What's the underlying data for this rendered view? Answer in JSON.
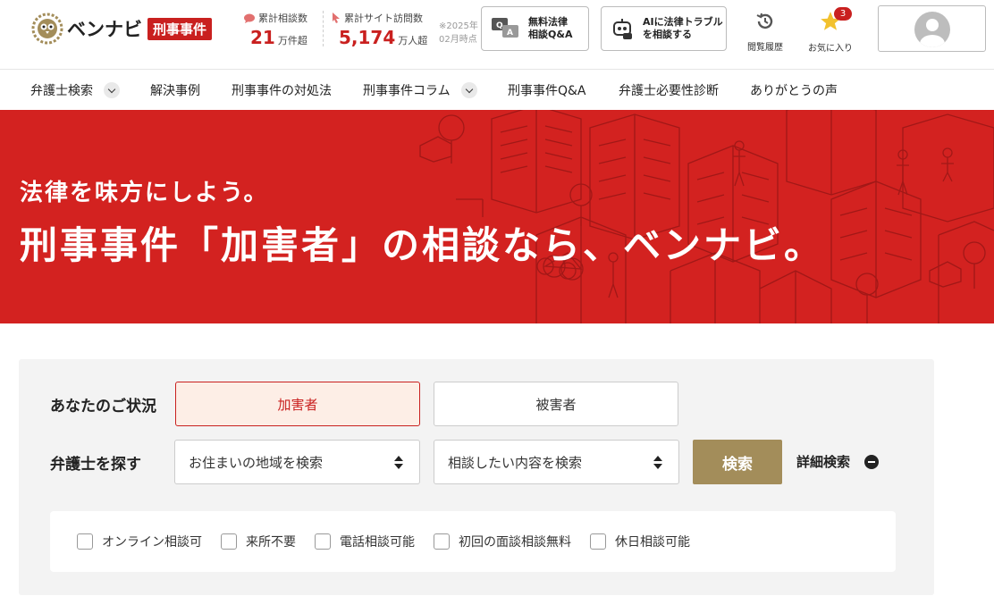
{
  "header": {
    "logo_text": "ベンナビ",
    "logo_badge": "刑事事件",
    "stats": [
      {
        "label": "累計相談数",
        "value": "21",
        "unit": "万件超"
      },
      {
        "label": "累計サイト訪問数",
        "value": "5,174",
        "unit": "万人超"
      }
    ],
    "stat_note_line1": "※2025年",
    "stat_note_line2": "02月時点",
    "qa_button": {
      "line1": "無料法律",
      "line2": "相談Q&A"
    },
    "ai_button": {
      "line1": "AIに法律トラブル",
      "line2": "を相談する"
    },
    "history_label": "閲覧履歴",
    "favorites_label": "お気に入り",
    "favorites_count": "3"
  },
  "nav": {
    "items": [
      {
        "label": "弁護士検索",
        "dropdown": true
      },
      {
        "label": "解決事例",
        "dropdown": false
      },
      {
        "label": "刑事事件の対処法",
        "dropdown": false
      },
      {
        "label": "刑事事件コラム",
        "dropdown": true
      },
      {
        "label": "刑事事件Q&A",
        "dropdown": false
      },
      {
        "label": "弁護士必要性診断",
        "dropdown": false
      },
      {
        "label": "ありがとうの声",
        "dropdown": false
      }
    ]
  },
  "hero": {
    "subtitle": "法律を味方にしよう。",
    "title": "刑事事件「加害者」の相談なら、ベンナビ。"
  },
  "search": {
    "situation_label": "あなたのご状況",
    "situation_options": [
      "加害者",
      "被害者"
    ],
    "situation_selected": "加害者",
    "find_label": "弁護士を探す",
    "region_select": "お住まいの地域を検索",
    "topic_select": "相談したい内容を検索",
    "search_button": "検索",
    "detail_label": "詳細検索",
    "checkboxes": [
      "オンライン相談可",
      "来所不要",
      "電話相談可能",
      "初回の面談相談無料",
      "休日相談可能"
    ]
  },
  "colors": {
    "brand_red": "#c9201f",
    "hero_red": "#d32220",
    "search_gold": "#a38d5a",
    "active_bg": "#fdeee6"
  }
}
